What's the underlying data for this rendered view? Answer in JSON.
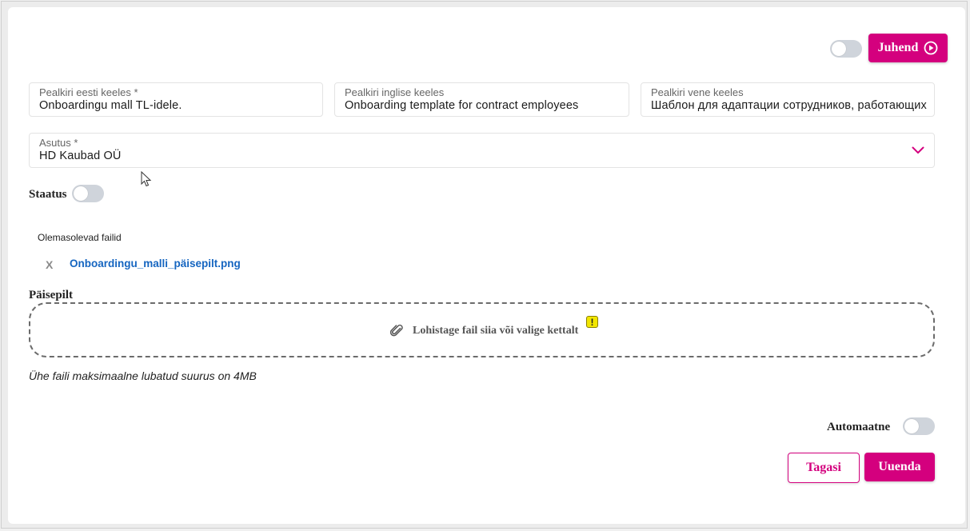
{
  "guide_button": {
    "label": "Juhend"
  },
  "fields": {
    "title_et": {
      "label": "Pealkiri eesti keeles *",
      "value": "Onboardingu mall TL-idele."
    },
    "title_en": {
      "label": "Pealkiri inglise keeles",
      "value": "Onboarding template for contract employees"
    },
    "title_ru": {
      "label": "Pealkiri vene keeles",
      "value": "Шаблон для адаптации сотрудников, работающих"
    },
    "institution": {
      "label": "Asutus *",
      "value": "HD Kaubad OÜ"
    }
  },
  "status": {
    "label": "Staatus"
  },
  "existing_files": {
    "heading": "Olemasolevad failid",
    "remove_glyph": "X",
    "files": [
      {
        "name": "Onboardingu_malli_päisepilt.png"
      }
    ]
  },
  "header_image": {
    "label": "Päisepilt",
    "dropzone_text": "Lohistage fail siia või valige kettalt",
    "warning_glyph": "!",
    "size_note": "Ühe faili maksimaalne lubatud suurus on 4MB"
  },
  "automatic": {
    "label": "Automaatne"
  },
  "actions": {
    "back_label": "Tagasi",
    "update_label": "Uuenda"
  },
  "colors": {
    "accent": "#d4007e",
    "link": "#1565c0",
    "warning": "#f2e600"
  }
}
